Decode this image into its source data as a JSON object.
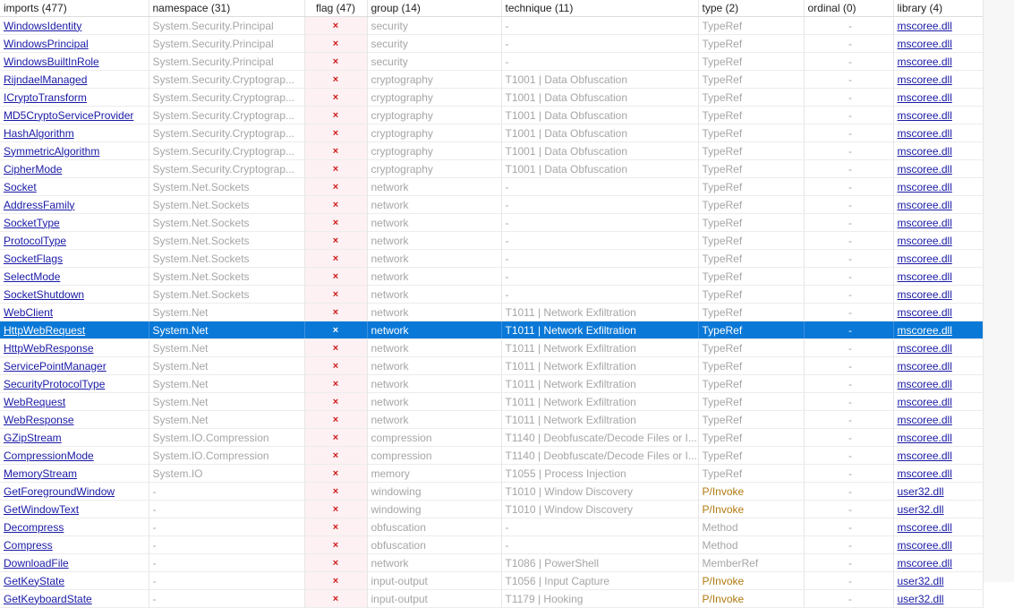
{
  "columns": [
    {
      "key": "import",
      "label": "imports (477)"
    },
    {
      "key": "namespace",
      "label": "namespace (31)"
    },
    {
      "key": "flag",
      "label": "flag (47)"
    },
    {
      "key": "group",
      "label": "group (14)"
    },
    {
      "key": "technique",
      "label": "technique (11)"
    },
    {
      "key": "type",
      "label": "type (2)"
    },
    {
      "key": "ordinal",
      "label": "ordinal (0)"
    },
    {
      "key": "library",
      "label": "library (4)"
    }
  ],
  "selected_row_index": 17,
  "colors": {
    "selection": "#0a78d7",
    "flag": "#d01818",
    "link": "#1a1aa6",
    "pinvoke": "#b07a10",
    "muted": "#a6a6a6"
  },
  "rows": [
    {
      "import": "WindowsIdentity",
      "namespace": "System.Security.Principal",
      "flag": "×",
      "group": "security",
      "technique": "-",
      "type": "TypeRef",
      "ordinal": "-",
      "library": "mscoree.dll"
    },
    {
      "import": "WindowsPrincipal",
      "namespace": "System.Security.Principal",
      "flag": "×",
      "group": "security",
      "technique": "-",
      "type": "TypeRef",
      "ordinal": "-",
      "library": "mscoree.dll"
    },
    {
      "import": "WindowsBuiltInRole",
      "namespace": "System.Security.Principal",
      "flag": "×",
      "group": "security",
      "technique": "-",
      "type": "TypeRef",
      "ordinal": "-",
      "library": "mscoree.dll"
    },
    {
      "import": "RijndaelManaged",
      "namespace": "System.Security.Cryptograp...",
      "flag": "×",
      "group": "cryptography",
      "technique": "T1001 | Data Obfuscation",
      "type": "TypeRef",
      "ordinal": "-",
      "library": "mscoree.dll"
    },
    {
      "import": "ICryptoTransform",
      "namespace": "System.Security.Cryptograp...",
      "flag": "×",
      "group": "cryptography",
      "technique": "T1001 | Data Obfuscation",
      "type": "TypeRef",
      "ordinal": "-",
      "library": "mscoree.dll"
    },
    {
      "import": "MD5CryptoServiceProvider",
      "namespace": "System.Security.Cryptograp...",
      "flag": "×",
      "group": "cryptography",
      "technique": "T1001 | Data Obfuscation",
      "type": "TypeRef",
      "ordinal": "-",
      "library": "mscoree.dll"
    },
    {
      "import": "HashAlgorithm",
      "namespace": "System.Security.Cryptograp...",
      "flag": "×",
      "group": "cryptography",
      "technique": "T1001 | Data Obfuscation",
      "type": "TypeRef",
      "ordinal": "-",
      "library": "mscoree.dll"
    },
    {
      "import": "SymmetricAlgorithm",
      "namespace": "System.Security.Cryptograp...",
      "flag": "×",
      "group": "cryptography",
      "technique": "T1001 | Data Obfuscation",
      "type": "TypeRef",
      "ordinal": "-",
      "library": "mscoree.dll"
    },
    {
      "import": "CipherMode",
      "namespace": "System.Security.Cryptograp...",
      "flag": "×",
      "group": "cryptography",
      "technique": "T1001 | Data Obfuscation",
      "type": "TypeRef",
      "ordinal": "-",
      "library": "mscoree.dll"
    },
    {
      "import": "Socket",
      "namespace": "System.Net.Sockets",
      "flag": "×",
      "group": "network",
      "technique": "-",
      "type": "TypeRef",
      "ordinal": "-",
      "library": "mscoree.dll"
    },
    {
      "import": "AddressFamily",
      "namespace": "System.Net.Sockets",
      "flag": "×",
      "group": "network",
      "technique": "-",
      "type": "TypeRef",
      "ordinal": "-",
      "library": "mscoree.dll"
    },
    {
      "import": "SocketType",
      "namespace": "System.Net.Sockets",
      "flag": "×",
      "group": "network",
      "technique": "-",
      "type": "TypeRef",
      "ordinal": "-",
      "library": "mscoree.dll"
    },
    {
      "import": "ProtocolType",
      "namespace": "System.Net.Sockets",
      "flag": "×",
      "group": "network",
      "technique": "-",
      "type": "TypeRef",
      "ordinal": "-",
      "library": "mscoree.dll"
    },
    {
      "import": "SocketFlags",
      "namespace": "System.Net.Sockets",
      "flag": "×",
      "group": "network",
      "technique": "-",
      "type": "TypeRef",
      "ordinal": "-",
      "library": "mscoree.dll"
    },
    {
      "import": "SelectMode",
      "namespace": "System.Net.Sockets",
      "flag": "×",
      "group": "network",
      "technique": "-",
      "type": "TypeRef",
      "ordinal": "-",
      "library": "mscoree.dll"
    },
    {
      "import": "SocketShutdown",
      "namespace": "System.Net.Sockets",
      "flag": "×",
      "group": "network",
      "technique": "-",
      "type": "TypeRef",
      "ordinal": "-",
      "library": "mscoree.dll"
    },
    {
      "import": "WebClient",
      "namespace": "System.Net",
      "flag": "×",
      "group": "network",
      "technique": "T1011 | Network Exfiltration",
      "type": "TypeRef",
      "ordinal": "-",
      "library": "mscoree.dll"
    },
    {
      "import": "HttpWebRequest",
      "namespace": "System.Net",
      "flag": "×",
      "group": "network",
      "technique": "T1011 | Network Exfiltration",
      "type": "TypeRef",
      "ordinal": "-",
      "library": "mscoree.dll"
    },
    {
      "import": "HttpWebResponse",
      "namespace": "System.Net",
      "flag": "×",
      "group": "network",
      "technique": "T1011 | Network Exfiltration",
      "type": "TypeRef",
      "ordinal": "-",
      "library": "mscoree.dll"
    },
    {
      "import": "ServicePointManager",
      "namespace": "System.Net",
      "flag": "×",
      "group": "network",
      "technique": "T1011 | Network Exfiltration",
      "type": "TypeRef",
      "ordinal": "-",
      "library": "mscoree.dll"
    },
    {
      "import": "SecurityProtocolType",
      "namespace": "System.Net",
      "flag": "×",
      "group": "network",
      "technique": "T1011 | Network Exfiltration",
      "type": "TypeRef",
      "ordinal": "-",
      "library": "mscoree.dll"
    },
    {
      "import": "WebRequest",
      "namespace": "System.Net",
      "flag": "×",
      "group": "network",
      "technique": "T1011 | Network Exfiltration",
      "type": "TypeRef",
      "ordinal": "-",
      "library": "mscoree.dll"
    },
    {
      "import": "WebResponse",
      "namespace": "System.Net",
      "flag": "×",
      "group": "network",
      "technique": "T1011 | Network Exfiltration",
      "type": "TypeRef",
      "ordinal": "-",
      "library": "mscoree.dll"
    },
    {
      "import": "GZipStream",
      "namespace": "System.IO.Compression",
      "flag": "×",
      "group": "compression",
      "technique": "T1140 | Deobfuscate/Decode Files or I...",
      "type": "TypeRef",
      "ordinal": "-",
      "library": "mscoree.dll"
    },
    {
      "import": "CompressionMode",
      "namespace": "System.IO.Compression",
      "flag": "×",
      "group": "compression",
      "technique": "T1140 | Deobfuscate/Decode Files or I...",
      "type": "TypeRef",
      "ordinal": "-",
      "library": "mscoree.dll"
    },
    {
      "import": "MemoryStream",
      "namespace": "System.IO",
      "flag": "×",
      "group": "memory",
      "technique": "T1055 | Process Injection",
      "type": "TypeRef",
      "ordinal": "-",
      "library": "mscoree.dll"
    },
    {
      "import": "GetForegroundWindow",
      "namespace": "-",
      "flag": "×",
      "group": "windowing",
      "technique": "T1010 | Window Discovery",
      "type": "P/Invoke",
      "ordinal": "-",
      "library": "user32.dll"
    },
    {
      "import": "GetWindowText",
      "namespace": "-",
      "flag": "×",
      "group": "windowing",
      "technique": "T1010 | Window Discovery",
      "type": "P/Invoke",
      "ordinal": "-",
      "library": "user32.dll"
    },
    {
      "import": "Decompress",
      "namespace": "-",
      "flag": "×",
      "group": "obfuscation",
      "technique": "-",
      "type": "Method",
      "ordinal": "-",
      "library": "mscoree.dll"
    },
    {
      "import": "Compress",
      "namespace": "-",
      "flag": "×",
      "group": "obfuscation",
      "technique": "-",
      "type": "Method",
      "ordinal": "-",
      "library": "mscoree.dll"
    },
    {
      "import": "DownloadFile",
      "namespace": "-",
      "flag": "×",
      "group": "network",
      "technique": "T1086 | PowerShell",
      "type": "MemberRef",
      "ordinal": "-",
      "library": "mscoree.dll"
    },
    {
      "import": "GetKeyState",
      "namespace": "-",
      "flag": "×",
      "group": "input-output",
      "technique": "T1056 | Input Capture",
      "type": "P/Invoke",
      "ordinal": "-",
      "library": "user32.dll"
    },
    {
      "import": "GetKeyboardState",
      "namespace": "-",
      "flag": "×",
      "group": "input-output",
      "technique": "T1179 | Hooking",
      "type": "P/Invoke",
      "ordinal": "-",
      "library": "user32.dll"
    }
  ]
}
